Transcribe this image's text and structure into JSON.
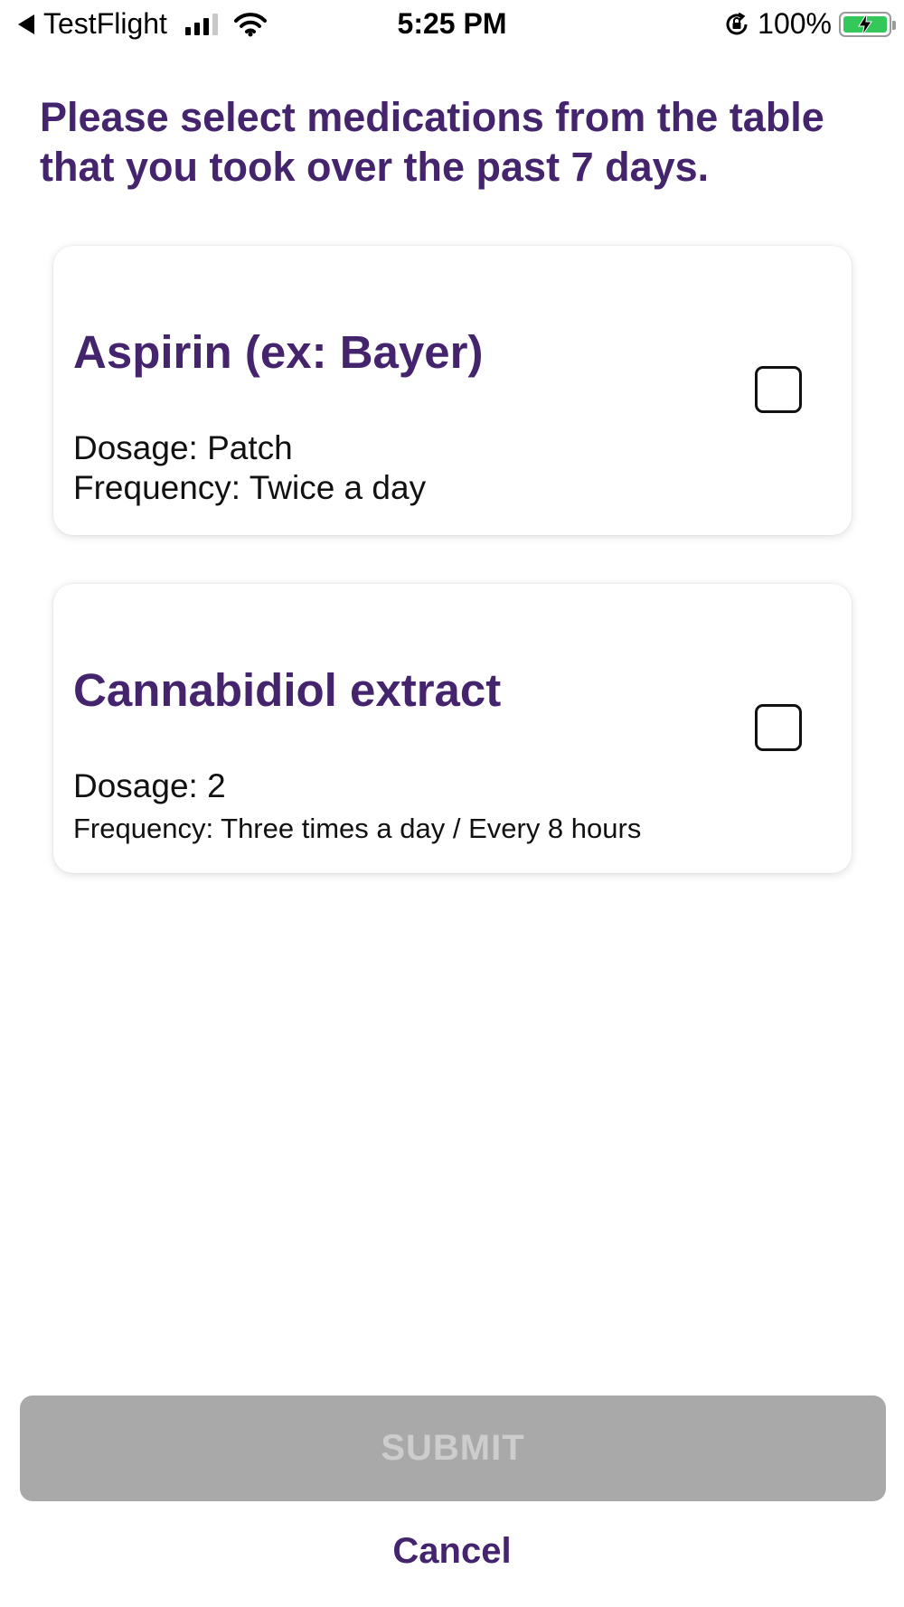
{
  "status_bar": {
    "back_app": "TestFlight",
    "time": "5:25 PM",
    "battery_percent": "100%",
    "battery_level": 1.0,
    "icons": [
      "back-arrow-icon",
      "cellular-signal-icon",
      "wifi-icon",
      "orientation-lock-icon",
      "battery-charging-icon"
    ]
  },
  "prompt": {
    "line1": "Please select medications from the table",
    "line2": "that you took over the past 7 days."
  },
  "medications": [
    {
      "name": "Aspirin (ex: Bayer)",
      "dosage": "Dosage: Patch",
      "frequency": "Frequency: Twice a day",
      "checked": false
    },
    {
      "name": "Cannabidiol extract",
      "dosage": "Dosage: 2",
      "frequency": "Frequency: Three times a day / Every 8 hours",
      "checked": false
    }
  ],
  "actions": {
    "submit_label": "SUBMIT",
    "submit_enabled": false,
    "cancel_label": "Cancel"
  },
  "colors": {
    "accent": "#43246d",
    "submit_disabled_bg": "#a9a9a9",
    "battery_green": "#34c759"
  }
}
